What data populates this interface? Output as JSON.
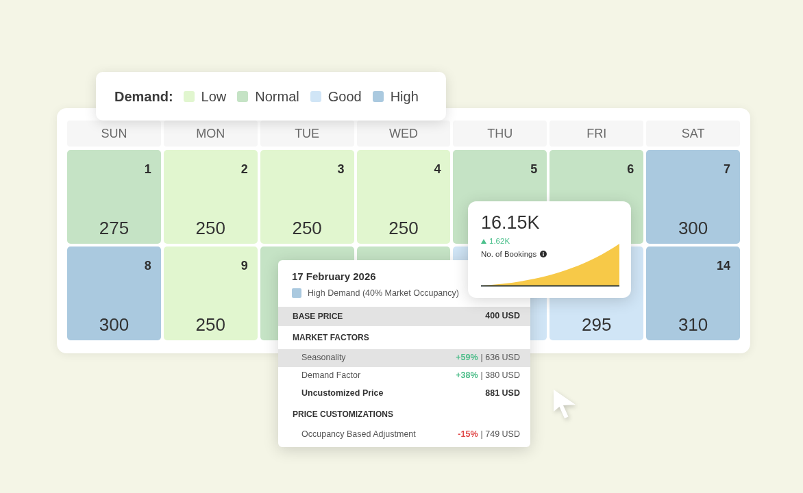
{
  "legend": {
    "title": "Demand:",
    "levels": [
      {
        "label": "Low",
        "color": "#e1f6cf"
      },
      {
        "label": "Normal",
        "color": "#c5e3c5"
      },
      {
        "label": "Good",
        "color": "#d0e5f6"
      },
      {
        "label": "High",
        "color": "#aac9df"
      }
    ]
  },
  "calendar": {
    "weekdays": [
      "SUN",
      "MON",
      "TUE",
      "WED",
      "THU",
      "FRI",
      "SAT"
    ],
    "weeks": [
      [
        {
          "day": "1",
          "price": "275",
          "color": "#c5e3c5"
        },
        {
          "day": "2",
          "price": "250",
          "color": "#e1f6cf"
        },
        {
          "day": "3",
          "price": "250",
          "color": "#e1f6cf"
        },
        {
          "day": "4",
          "price": "250",
          "color": "#e1f6cf"
        },
        {
          "day": "5",
          "color": "#c5e3c5"
        },
        {
          "day": "6",
          "color": "#c5e3c5"
        },
        {
          "day": "7",
          "price": "300",
          "color": "#aac9df"
        }
      ],
      [
        {
          "day": "8",
          "price": "300",
          "color": "#aac9df"
        },
        {
          "day": "9",
          "price": "250",
          "color": "#e1f6cf"
        },
        {
          "color": "#c5e3c5"
        },
        {
          "color": "#c5e3c5"
        },
        {
          "color": "#d0e5f6"
        },
        {
          "price": "295",
          "color": "#d0e5f6"
        },
        {
          "day": "14",
          "price": "310",
          "color": "#aac9df"
        }
      ]
    ]
  },
  "price_breakdown": {
    "date": "17 February 2026",
    "demand": {
      "label": "High Demand (40% Market Occupancy)",
      "color": "#aac9df"
    },
    "rows": [
      {
        "kind": "section",
        "label": "BASE PRICE",
        "amount": "400 USD",
        "highlighted": true
      },
      {
        "kind": "section",
        "label": "MARKET FACTORS",
        "highlighted": false
      },
      {
        "kind": "factor",
        "label": "Seasonality",
        "change": "+59%",
        "color": "#4cbd89",
        "amount": "| 636 USD",
        "highlighted": true
      },
      {
        "kind": "factor",
        "label": "Demand Factor",
        "change": "+38%",
        "color": "#4cbd89",
        "amount": "| 380 USD",
        "highlighted": false
      },
      {
        "kind": "subtotal",
        "label": "Uncustomized Price",
        "amount": "881 USD",
        "highlighted": false
      },
      {
        "kind": "section",
        "label": "PRICE CUSTOMIZATIONS",
        "highlighted": false
      },
      {
        "kind": "factor",
        "label": "Occupancy Based Adjustment",
        "change": "-15%",
        "color": "#e04848",
        "amount": "| 749 USD",
        "highlighted": false
      }
    ]
  },
  "bookings_card": {
    "value": "16.15K",
    "change": "1.62K",
    "label": "No. of Bookings"
  }
}
